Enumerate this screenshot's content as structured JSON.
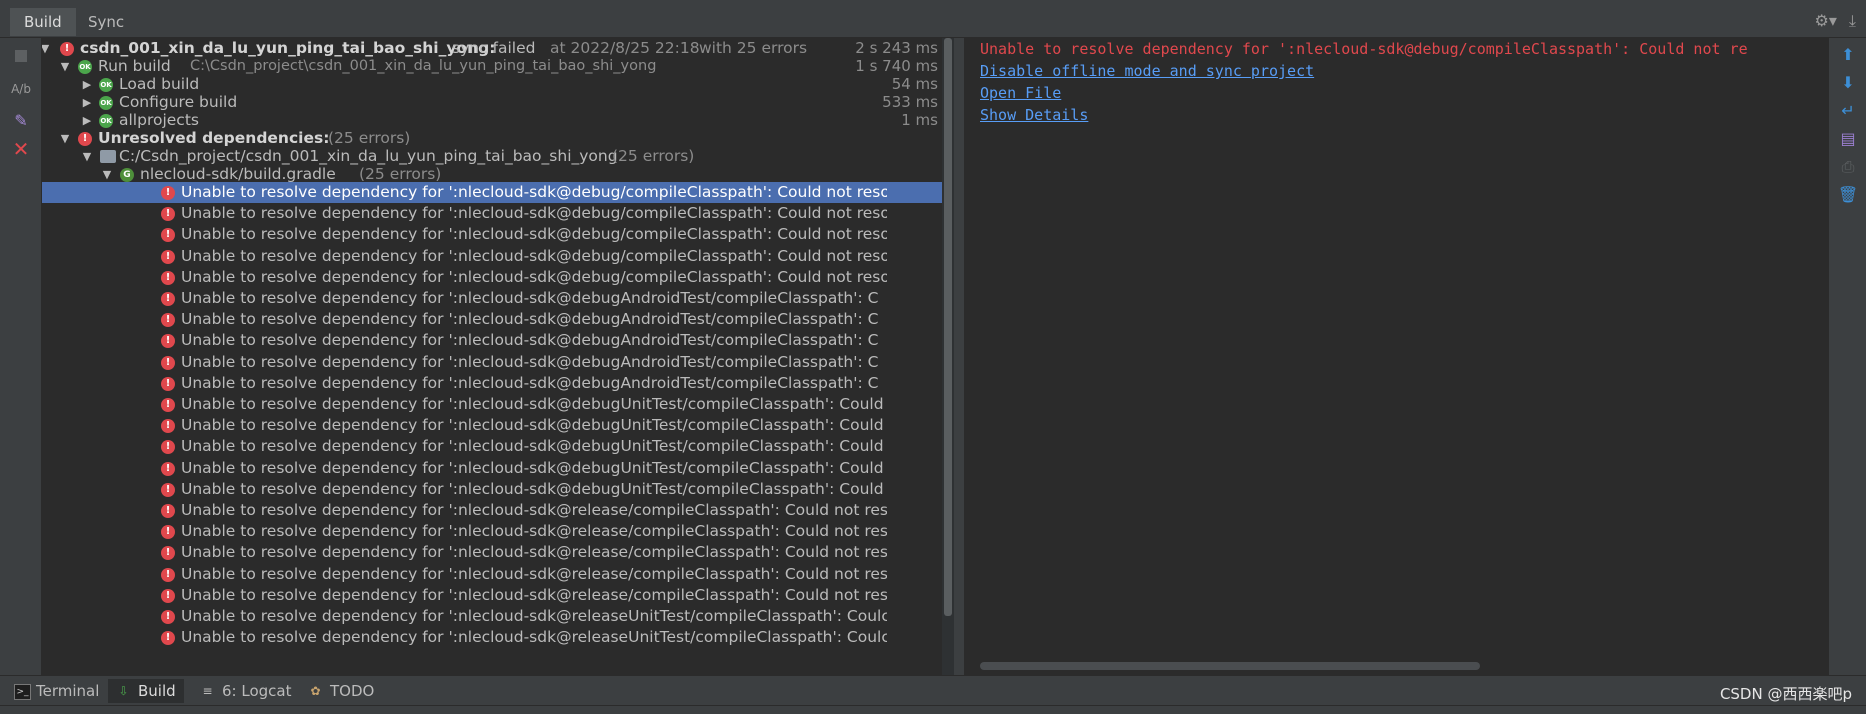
{
  "tabs": {
    "build": "Build",
    "sync": "Sync"
  },
  "toolbar_icons": {
    "settings": "gear-icon",
    "download": "download-icon"
  },
  "tree": {
    "root": {
      "project": "csdn_001_xin_da_lu_yun_ping_tai_bao_shi_yong:",
      "status": "sync failed",
      "time": "at 2022/8/25 22:18",
      "errors": "with 25 errors",
      "duration": "2 s 243 ms"
    },
    "run_build": {
      "label": "Run build",
      "path": "C:\\Csdn_project\\csdn_001_xin_da_lu_yun_ping_tai_bao_shi_yong",
      "duration": "1 s 740 ms"
    },
    "load_build": {
      "label": "Load build",
      "duration": "54 ms"
    },
    "configure_build": {
      "label": "Configure build",
      "duration": "533 ms"
    },
    "allprojects": {
      "label": "allprojects",
      "duration": "1 ms"
    },
    "unresolved": {
      "label": "Unresolved dependencies:",
      "count": "(25 errors)"
    },
    "folder": {
      "path": "C:/Csdn_project/csdn_001_xin_da_lu_yun_ping_tai_bao_shi_yong",
      "count": "(25 errors)"
    },
    "gradle": {
      "file": "nlecloud-sdk/build.gradle",
      "count": "(25 errors)"
    },
    "errors": [
      "Unable to resolve dependency for ':nlecloud-sdk@debug/compileClasspath': Could not reso",
      "Unable to resolve dependency for ':nlecloud-sdk@debug/compileClasspath': Could not reso",
      "Unable to resolve dependency for ':nlecloud-sdk@debug/compileClasspath': Could not reso",
      "Unable to resolve dependency for ':nlecloud-sdk@debug/compileClasspath': Could not reso",
      "Unable to resolve dependency for ':nlecloud-sdk@debug/compileClasspath': Could not reso",
      "Unable to resolve dependency for ':nlecloud-sdk@debugAndroidTest/compileClasspath': C",
      "Unable to resolve dependency for ':nlecloud-sdk@debugAndroidTest/compileClasspath': C",
      "Unable to resolve dependency for ':nlecloud-sdk@debugAndroidTest/compileClasspath': C",
      "Unable to resolve dependency for ':nlecloud-sdk@debugAndroidTest/compileClasspath': C",
      "Unable to resolve dependency for ':nlecloud-sdk@debugAndroidTest/compileClasspath': C",
      "Unable to resolve dependency for ':nlecloud-sdk@debugUnitTest/compileClasspath': Could",
      "Unable to resolve dependency for ':nlecloud-sdk@debugUnitTest/compileClasspath': Could",
      "Unable to resolve dependency for ':nlecloud-sdk@debugUnitTest/compileClasspath': Could",
      "Unable to resolve dependency for ':nlecloud-sdk@debugUnitTest/compileClasspath': Could",
      "Unable to resolve dependency for ':nlecloud-sdk@debugUnitTest/compileClasspath': Could",
      "Unable to resolve dependency for ':nlecloud-sdk@release/compileClasspath': Could not res",
      "Unable to resolve dependency for ':nlecloud-sdk@release/compileClasspath': Could not res",
      "Unable to resolve dependency for ':nlecloud-sdk@release/compileClasspath': Could not res",
      "Unable to resolve dependency for ':nlecloud-sdk@release/compileClasspath': Could not res",
      "Unable to resolve dependency for ':nlecloud-sdk@release/compileClasspath': Could not res",
      "Unable to resolve dependency for ':nlecloud-sdk@releaseUnitTest/compileClasspath': Coulc",
      "Unable to resolve dependency for ':nlecloud-sdk@releaseUnitTest/compileClasspath': Coulc"
    ]
  },
  "console": {
    "error_line": "Unable to resolve dependency for ':nlecloud-sdk@debug/compileClasspath': Could not re",
    "link_offline": "Disable offline mode and sync project",
    "link_open": "Open File",
    "link_details": "Show Details"
  },
  "bottom_tabs": {
    "terminal": "Terminal",
    "build": "Build",
    "logcat": "6: Logcat",
    "todo": "TODO"
  },
  "watermark": "CSDN @西西楽吧p",
  "colors": {
    "error": "#e0484d",
    "ok": "#4ba54b",
    "selection": "#4b6eaf",
    "link": "#589df6"
  }
}
